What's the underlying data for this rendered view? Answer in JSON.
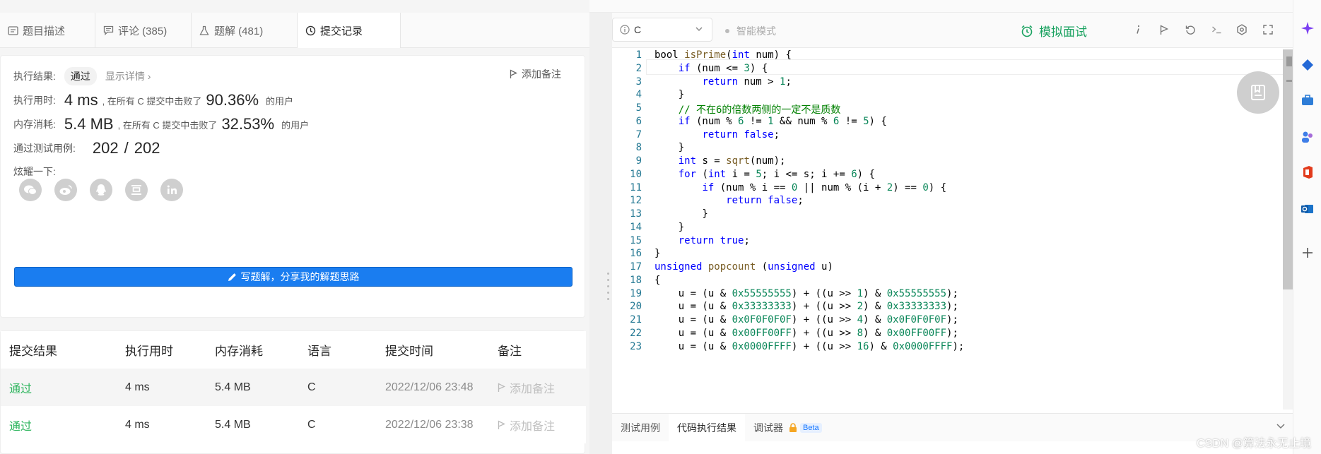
{
  "left_tabs": [
    {
      "label": "题目描述",
      "icon": "doc-icon"
    },
    {
      "label": "评论 (385)",
      "icon": "comment-icon"
    },
    {
      "label": "题解 (481)",
      "icon": "flask-icon"
    },
    {
      "label": "提交记录",
      "icon": "clock-icon"
    }
  ],
  "result": {
    "status_label": "执行结果:",
    "status_value": "通过",
    "details_link": "显示详情 ›",
    "add_note": "添加备注",
    "time_label": "执行用时:",
    "time_value": "4 ms",
    "time_beat_text": ", 在所有 C 提交中击败了",
    "time_percent": "90.36%",
    "users_suffix": "的用户",
    "mem_label": "内存消耗:",
    "mem_value": "5.4 MB",
    "mem_beat_text": ", 在所有 C 提交中击败了",
    "mem_percent": "32.53%",
    "tests_label": "通过测试用例:",
    "tests_passed": "202",
    "tests_sep": "/",
    "tests_total": "202",
    "share_label": "炫耀一下:",
    "write_button": "写题解，分享我的解题思路"
  },
  "history": {
    "headers": [
      "提交结果",
      "执行用时",
      "内存消耗",
      "语言",
      "提交时间",
      "备注"
    ],
    "rows": [
      {
        "result": "通过",
        "time": "4 ms",
        "memory": "5.4 MB",
        "lang": "C",
        "submitted": "2022/12/06 23:48",
        "note": "添加备注"
      },
      {
        "result": "通过",
        "time": "4 ms",
        "memory": "5.4 MB",
        "lang": "C",
        "submitted": "2022/12/06 23:38",
        "note": "添加备注"
      }
    ]
  },
  "editor": {
    "language": "C",
    "smart_mode": "智能模式",
    "mock_interview": "模拟面试",
    "bottom_tabs": [
      "测试用例",
      "代码执行结果",
      "调试器"
    ],
    "beta_badge": "Beta"
  },
  "watermark": "CSDN @算法永无止境",
  "colors": {
    "accent_blue": "#1a7df0",
    "success_green": "#2db55d",
    "interview_green": "#1aa260"
  }
}
